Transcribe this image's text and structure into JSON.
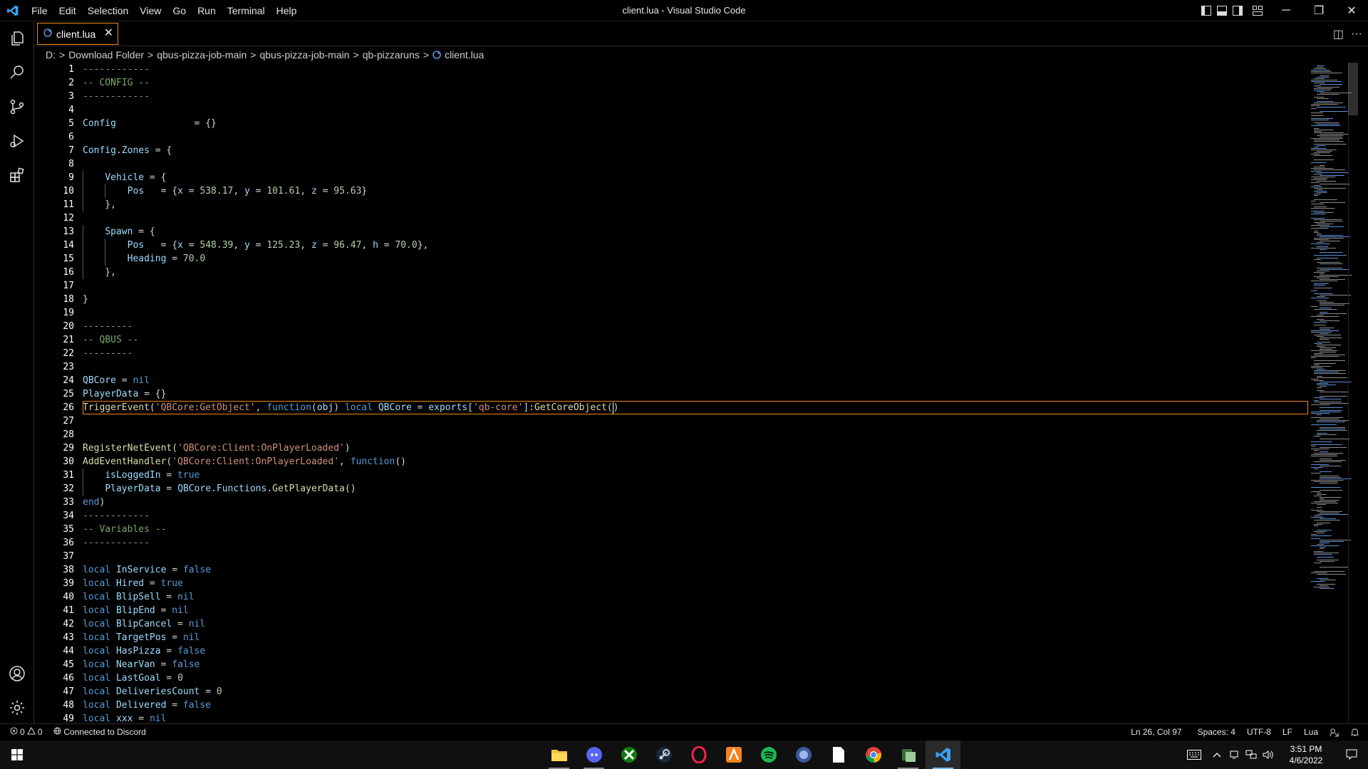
{
  "window": {
    "title": "client.lua - Visual Studio Code",
    "minimize_glyph": "─",
    "maximize_glyph": "❐",
    "close_glyph": "✕"
  },
  "menu": [
    "File",
    "Edit",
    "Selection",
    "View",
    "Go",
    "Run",
    "Terminal",
    "Help"
  ],
  "tab": {
    "label": "client.lua",
    "close": "✕"
  },
  "editor_actions": {
    "split": "◫",
    "more": "···"
  },
  "breadcrumbs": [
    "D:",
    "Download Folder",
    "qbus-pizza-job-main",
    "qbus-pizza-job-main",
    "qb-pizzaruns",
    "client.lua"
  ],
  "breadcrumb_separator": ">",
  "editor": {
    "current_line": 26,
    "lines": [
      [
        [
          "c",
          "------------"
        ]
      ],
      [
        [
          "c",
          "-- CONFIG --"
        ]
      ],
      [
        [
          "c",
          "------------"
        ]
      ],
      [],
      [
        [
          "i",
          "Config"
        ],
        [
          "o",
          "              = {}"
        ]
      ],
      [],
      [
        [
          "i",
          "Config"
        ],
        [
          "o",
          "."
        ],
        [
          "i",
          "Zones"
        ],
        [
          "o",
          " = {"
        ]
      ],
      [],
      [
        [
          "o",
          "    "
        ],
        [
          "i",
          "Vehicle"
        ],
        [
          "o",
          " = {"
        ]
      ],
      [
        [
          "o",
          "        "
        ],
        [
          "i",
          "Pos"
        ],
        [
          "o",
          "   = {"
        ],
        [
          "i",
          "x"
        ],
        [
          "o",
          " = "
        ],
        [
          "n",
          "538.17"
        ],
        [
          "o",
          ", "
        ],
        [
          "i",
          "y"
        ],
        [
          "o",
          " = "
        ],
        [
          "n",
          "101.61"
        ],
        [
          "o",
          ", "
        ],
        [
          "i",
          "z"
        ],
        [
          "o",
          " = "
        ],
        [
          "n",
          "95.63"
        ],
        [
          "o",
          "}"
        ]
      ],
      [
        [
          "o",
          "    },"
        ]
      ],
      [],
      [
        [
          "o",
          "    "
        ],
        [
          "i",
          "Spawn"
        ],
        [
          "o",
          " = {"
        ]
      ],
      [
        [
          "o",
          "        "
        ],
        [
          "i",
          "Pos"
        ],
        [
          "o",
          "   = {"
        ],
        [
          "i",
          "x"
        ],
        [
          "o",
          " = "
        ],
        [
          "n",
          "548.39"
        ],
        [
          "o",
          ", "
        ],
        [
          "i",
          "y"
        ],
        [
          "o",
          " = "
        ],
        [
          "n",
          "125.23"
        ],
        [
          "o",
          ", "
        ],
        [
          "i",
          "z"
        ],
        [
          "o",
          " = "
        ],
        [
          "n",
          "96.47"
        ],
        [
          "o",
          ", "
        ],
        [
          "i",
          "h"
        ],
        [
          "o",
          " = "
        ],
        [
          "n",
          "70.0"
        ],
        [
          "o",
          "},"
        ]
      ],
      [
        [
          "o",
          "        "
        ],
        [
          "i",
          "Heading"
        ],
        [
          "o",
          " = "
        ],
        [
          "n",
          "70.0"
        ]
      ],
      [
        [
          "o",
          "    },"
        ]
      ],
      [],
      [
        [
          "o",
          "}"
        ]
      ],
      [],
      [
        [
          "c",
          "---------"
        ]
      ],
      [
        [
          "c",
          "-- QBUS --"
        ]
      ],
      [
        [
          "c",
          "---------"
        ]
      ],
      [],
      [
        [
          "i",
          "QBCore"
        ],
        [
          "o",
          " = "
        ],
        [
          "k",
          "nil"
        ]
      ],
      [
        [
          "i",
          "PlayerData"
        ],
        [
          "o",
          " = {}"
        ]
      ],
      [
        [
          "f",
          "TriggerEvent"
        ],
        [
          "o",
          "("
        ],
        [
          "s",
          "'QBCore:GetObject'"
        ],
        [
          "o",
          ", "
        ],
        [
          "k",
          "function"
        ],
        [
          "o",
          "("
        ],
        [
          "i",
          "obj"
        ],
        [
          "o",
          ") "
        ],
        [
          "k",
          "local"
        ],
        [
          "o",
          " "
        ],
        [
          "i",
          "QBCore"
        ],
        [
          "o",
          " = "
        ],
        [
          "i",
          "exports"
        ],
        [
          "o",
          "["
        ],
        [
          "s",
          "'qb-core'"
        ],
        [
          "o",
          "]:"
        ],
        [
          "f",
          "GetCoreObject"
        ],
        [
          "o",
          "("
        ],
        [
          "cur",
          ""
        ],
        [
          "o",
          ")"
        ]
      ],
      [],
      [],
      [
        [
          "f",
          "RegisterNetEvent"
        ],
        [
          "o",
          "("
        ],
        [
          "s",
          "'QBCore:Client:OnPlayerLoaded'"
        ],
        [
          "o",
          ")"
        ]
      ],
      [
        [
          "f",
          "AddEventHandler"
        ],
        [
          "o",
          "("
        ],
        [
          "s",
          "'QBCore:Client:OnPlayerLoaded'"
        ],
        [
          "o",
          ", "
        ],
        [
          "k",
          "function"
        ],
        [
          "o",
          "()"
        ]
      ],
      [
        [
          "o",
          "    "
        ],
        [
          "i",
          "isLoggedIn"
        ],
        [
          "o",
          " = "
        ],
        [
          "k",
          "true"
        ]
      ],
      [
        [
          "o",
          "    "
        ],
        [
          "i",
          "PlayerData"
        ],
        [
          "o",
          " = "
        ],
        [
          "i",
          "QBCore"
        ],
        [
          "o",
          "."
        ],
        [
          "i",
          "Functions"
        ],
        [
          "o",
          "."
        ],
        [
          "f",
          "GetPlayerData"
        ],
        [
          "o",
          "()"
        ]
      ],
      [
        [
          "k",
          "end"
        ],
        [
          "o",
          ")"
        ]
      ],
      [
        [
          "c",
          "------------"
        ]
      ],
      [
        [
          "c",
          "-- Variables --"
        ]
      ],
      [
        [
          "c",
          "------------"
        ]
      ],
      [],
      [
        [
          "k",
          "local"
        ],
        [
          "o",
          " "
        ],
        [
          "i",
          "InService"
        ],
        [
          "o",
          " = "
        ],
        [
          "k",
          "false"
        ]
      ],
      [
        [
          "k",
          "local"
        ],
        [
          "o",
          " "
        ],
        [
          "i",
          "Hired"
        ],
        [
          "o",
          " = "
        ],
        [
          "k",
          "true"
        ]
      ],
      [
        [
          "k",
          "local"
        ],
        [
          "o",
          " "
        ],
        [
          "i",
          "BlipSell"
        ],
        [
          "o",
          " = "
        ],
        [
          "k",
          "nil"
        ]
      ],
      [
        [
          "k",
          "local"
        ],
        [
          "o",
          " "
        ],
        [
          "i",
          "BlipEnd"
        ],
        [
          "o",
          " = "
        ],
        [
          "k",
          "nil"
        ]
      ],
      [
        [
          "k",
          "local"
        ],
        [
          "o",
          " "
        ],
        [
          "i",
          "BlipCancel"
        ],
        [
          "o",
          " = "
        ],
        [
          "k",
          "nil"
        ]
      ],
      [
        [
          "k",
          "local"
        ],
        [
          "o",
          " "
        ],
        [
          "i",
          "TargetPos"
        ],
        [
          "o",
          " = "
        ],
        [
          "k",
          "nil"
        ]
      ],
      [
        [
          "k",
          "local"
        ],
        [
          "o",
          " "
        ],
        [
          "i",
          "HasPizza"
        ],
        [
          "o",
          " = "
        ],
        [
          "k",
          "false"
        ]
      ],
      [
        [
          "k",
          "local"
        ],
        [
          "o",
          " "
        ],
        [
          "i",
          "NearVan"
        ],
        [
          "o",
          " = "
        ],
        [
          "k",
          "false"
        ]
      ],
      [
        [
          "k",
          "local"
        ],
        [
          "o",
          " "
        ],
        [
          "i",
          "LastGoal"
        ],
        [
          "o",
          " = "
        ],
        [
          "n",
          "0"
        ]
      ],
      [
        [
          "k",
          "local"
        ],
        [
          "o",
          " "
        ],
        [
          "i",
          "DeliveriesCount"
        ],
        [
          "o",
          " = "
        ],
        [
          "n",
          "0"
        ]
      ],
      [
        [
          "k",
          "local"
        ],
        [
          "o",
          " "
        ],
        [
          "i",
          "Delivered"
        ],
        [
          "o",
          " = "
        ],
        [
          "k",
          "false"
        ]
      ],
      [
        [
          "k",
          "local"
        ],
        [
          "o",
          " "
        ],
        [
          "i",
          "xxx"
        ],
        [
          "o",
          " = "
        ],
        [
          "k",
          "nil"
        ]
      ]
    ]
  },
  "colors": {
    "comment": "#7ca668",
    "keyword": "#569cd6",
    "identifier": "#9cdcfe",
    "function": "#dcdcaa",
    "string": "#ce9178",
    "number": "#b5cea8",
    "accent_border": "#f38518"
  },
  "status": {
    "errors": "0",
    "warnings": "0",
    "discord": "Connected to Discord",
    "position": "Ln 26, Col 97",
    "spaces": "Spaces: 4",
    "encoding": "UTF-8",
    "eol": "LF",
    "language": "Lua"
  },
  "taskbar": {
    "apps": [
      "file-explorer-icon",
      "discord-icon",
      "xbox-icon",
      "steam-icon",
      "opera-gx-icon",
      "app-icon",
      "spotify-icon",
      "app-icon",
      "notepad-icon",
      "chrome-icon",
      "app-icon",
      "vscode-icon"
    ],
    "time": "3:51 PM",
    "date": "4/6/2022"
  }
}
